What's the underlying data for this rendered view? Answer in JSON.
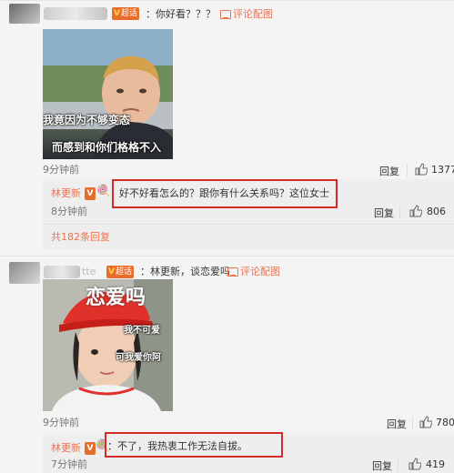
{
  "comment1": {
    "badge_label": "超话",
    "text": "：你好看？？？",
    "view_image": "评论配图",
    "image_caption_line1": "我竟因为不够变态",
    "image_caption_line2": "而感到和你们格格不入",
    "time": "9分钟前",
    "reply_label": "回复",
    "likes": "1377",
    "reply": {
      "author": "林更新",
      "text": "好不好看怎么的？跟你有什么关系吗？这位女士",
      "time": "8分钟前",
      "reply_label": "回复",
      "likes": "806"
    },
    "more_replies": "共182条回复"
  },
  "comment2": {
    "name_suffix": "tte",
    "badge_label": "超话",
    "text": "：林更新，谈恋爱吗",
    "view_image": "评论配图",
    "image_caption_big": "恋爱吗",
    "image_caption_line1": "我不可爱",
    "image_caption_line2": "可我爱你阿",
    "time": "9分钟前",
    "reply_label": "回复",
    "likes": "780",
    "reply": {
      "author": "林更新",
      "text": "：不了，我热衷工作无法自拔。",
      "time": "7分钟前",
      "reply_label": "回复",
      "likes": "419"
    }
  },
  "colors": {
    "accent": "#eb7350",
    "highlight_box": "#d42b2b",
    "badge": "#e86d2a"
  }
}
